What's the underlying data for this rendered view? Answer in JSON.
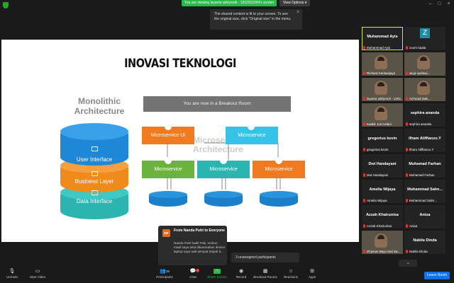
{
  "topbar": {
    "viewing": "You are viewing Isyanto adriyendi - 1202911004's screen",
    "view_options": "View Options",
    "tooltip": "The shared content is fit to your screen. To see the original size, click \"Original size\" in the menu."
  },
  "slide": {
    "title": "INOVASI TEKNOLOGI",
    "mono_title_1": "Monolithic",
    "mono_title_2": "Architecture",
    "micro_title_1": "Microservice",
    "micro_title_2": "Architecture",
    "layers": [
      "User Interface",
      "Business Layer",
      "Data Interface"
    ],
    "services_top": [
      "Microservice UI",
      "Microservice"
    ],
    "services_bottom": [
      "Microservice",
      "Microservice",
      "Microservice"
    ],
    "colors": {
      "blue": "#1e88d6",
      "orange": "#f08a1c",
      "teal": "#2bb4b0",
      "green": "#6cb33e",
      "light_blue": "#37c3e8"
    }
  },
  "breakout_overlay": "You are now in a Breakout Room",
  "chat_toast": {
    "avatar": "NP",
    "from": "From Nanda Putri to Everyone",
    "message": "Nanda Putri hadir Pak, mohon maaf saya telat dikarenakan device laptop saya tadi sempat terjadi b..."
  },
  "unassigned": "3 unassigned participants",
  "participants": [
    {
      "big": "Muhammad Ayis",
      "name": "Muhammad Ayis",
      "active": true
    },
    {
      "big": "Z",
      "name": "zoom baala",
      "zoom": true
    },
    {
      "name": "Richard Kartawijaya",
      "video": true
    },
    {
      "name": "wiqa syafawi...",
      "video": true
    },
    {
      "name": "isyanto adriyendi - 1202...",
      "video": true
    },
    {
      "name": "Achmad Zaki...",
      "video": true
    },
    {
      "name": "Kadek Juli Ardani",
      "video": true
    },
    {
      "big": "sephira ananda",
      "name": "sephira ananda"
    },
    {
      "big": "gregorius kevin",
      "name": "gregorius kevin"
    },
    {
      "big": "Ilham Aliffianzo.Y",
      "name": "Ilham Aliffianzo.Y"
    },
    {
      "big": "Dwi Handayani",
      "name": "Dwi Handayani"
    },
    {
      "big": "Muhamad Farhan",
      "name": "Muhamad Farhan"
    },
    {
      "big": "Amelia Wijaya",
      "name": "Amelia Wijaya"
    },
    {
      "big": "Muhammad Salm...",
      "name": "Muhammad Salm..."
    },
    {
      "big": "Azzah Khairunisa",
      "name": "Azzah Khairunisa"
    },
    {
      "big": "Anisa",
      "name": "Anisa"
    },
    {
      "name": "Dhymas Bayu Dwi Sa...",
      "video": true
    },
    {
      "big": "Nabila Dinda",
      "name": "Nabila Dinda"
    }
  ],
  "toolbar": {
    "unmute": "Unmute",
    "start_video": "Start Video",
    "participants": "Participants",
    "participants_count": "29",
    "chat": "Chat",
    "chat_badge": "3",
    "share": "Share Screen",
    "record": "Record",
    "breakout": "Breakout Rooms",
    "reactions": "Reactions",
    "apps": "Apps",
    "leave": "Leave Room"
  }
}
